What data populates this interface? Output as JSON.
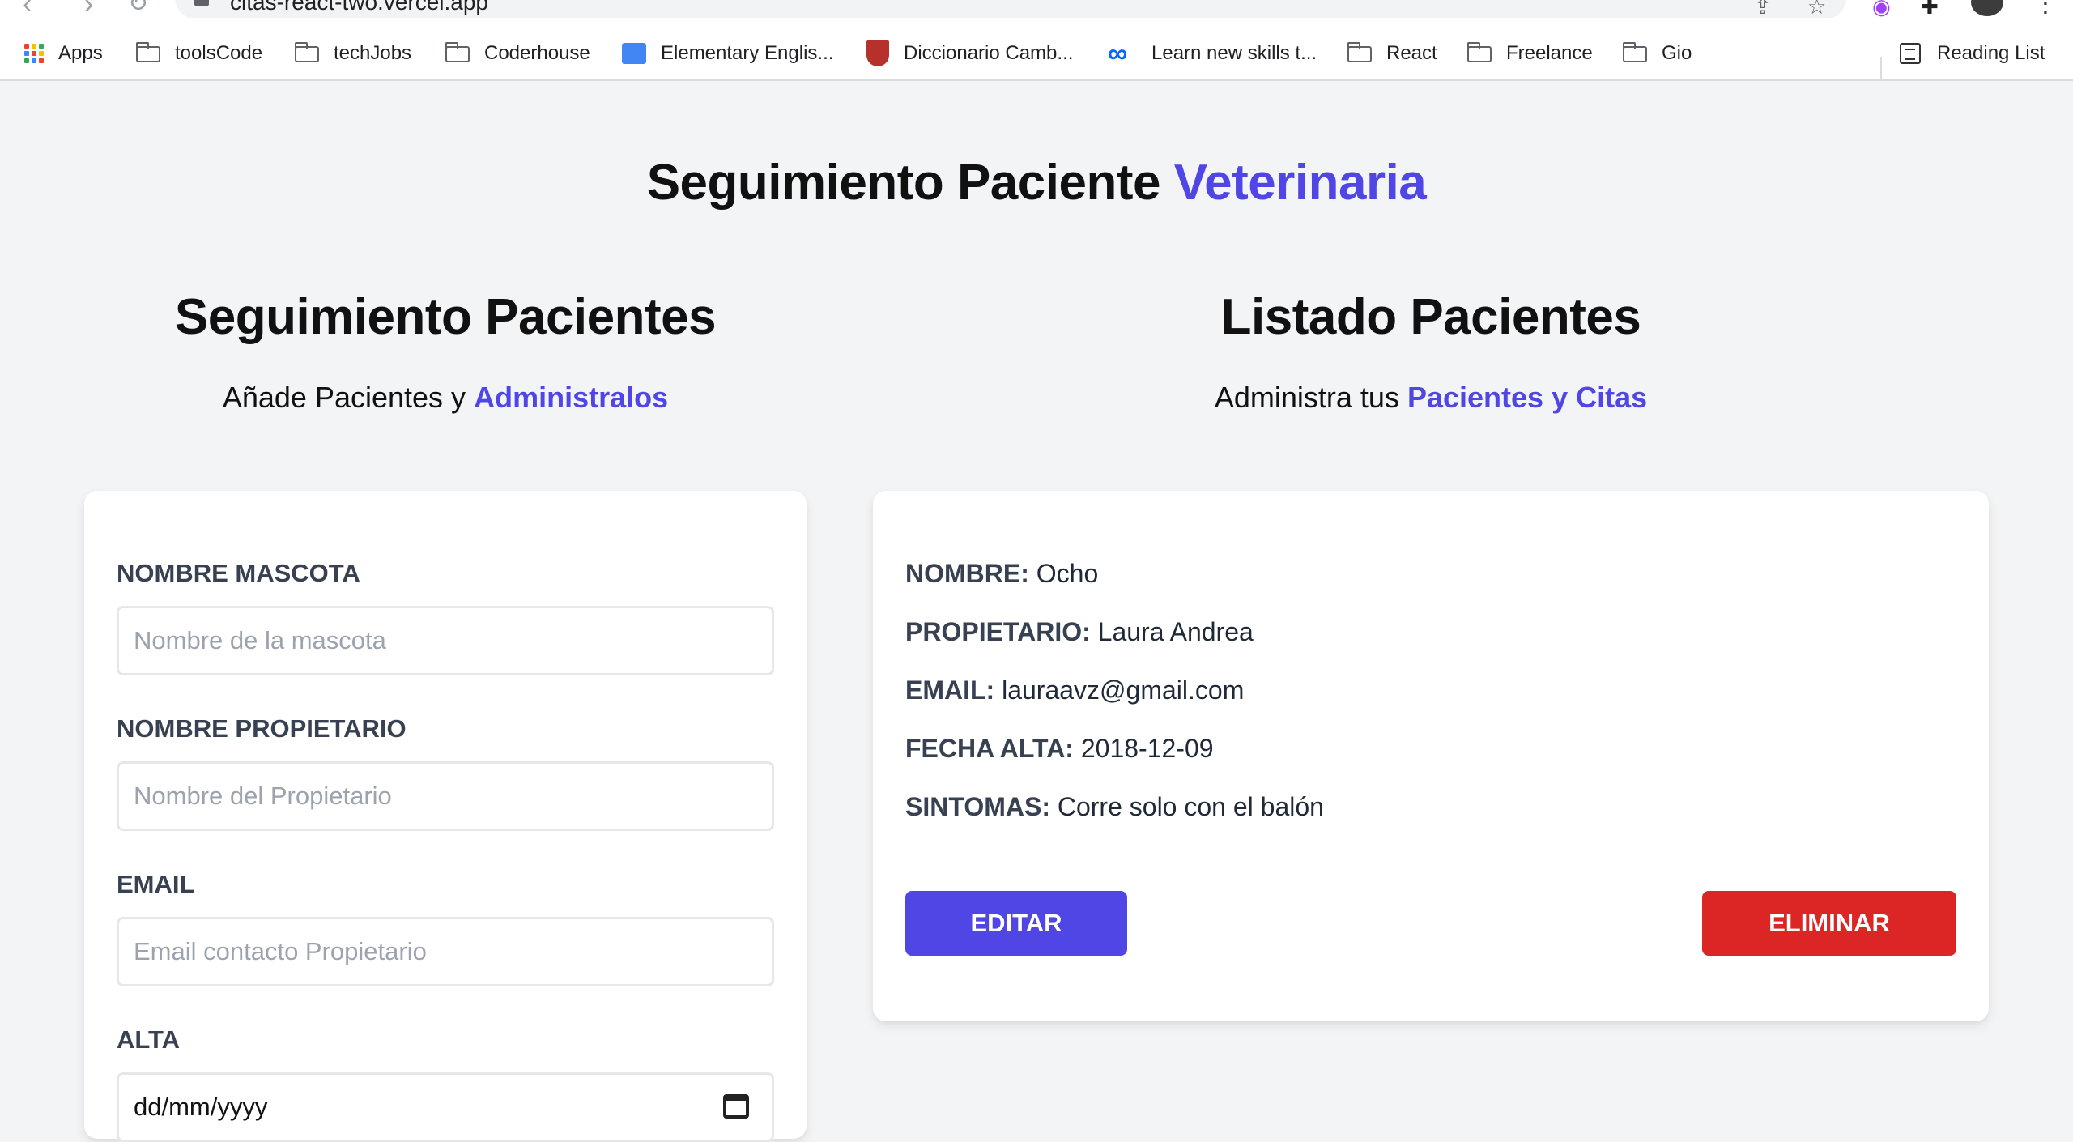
{
  "browser": {
    "url": "citas-react-two.vercel.app",
    "bookmarks": [
      {
        "label": "Apps",
        "icon": "apps-grid-icon"
      },
      {
        "label": "toolsCode",
        "icon": "folder-icon"
      },
      {
        "label": "techJobs",
        "icon": "folder-icon"
      },
      {
        "label": "Coderhouse",
        "icon": "folder-icon"
      },
      {
        "label": "Elementary Englis...",
        "icon": "contact-card-icon"
      },
      {
        "label": "Diccionario Camb...",
        "icon": "cambridge-shield-icon"
      },
      {
        "label": "Learn new skills t...",
        "icon": "meta-infinity-icon"
      },
      {
        "label": "React",
        "icon": "folder-icon"
      },
      {
        "label": "Freelance",
        "icon": "folder-icon"
      },
      {
        "label": "Gio",
        "icon": "folder-icon"
      }
    ],
    "reading_list": "Reading List"
  },
  "header": {
    "title_part1": "Seguimiento Paciente",
    "title_part2": "Veterinaria"
  },
  "form_section": {
    "title": "Seguimiento Pacientes",
    "subtitle_part1": "Añade Pacientes y",
    "subtitle_part2": "Administralos",
    "fields": [
      {
        "label": "NOMBRE MASCOTA",
        "placeholder": "Nombre de la mascota"
      },
      {
        "label": "NOMBRE PROPIETARIO",
        "placeholder": "Nombre del Propietario"
      },
      {
        "label": "EMAIL",
        "placeholder": "Email contacto Propietario"
      },
      {
        "label": "ALTA",
        "value": "dd/mm/yyyy"
      }
    ]
  },
  "list_section": {
    "title": "Listado Pacientes",
    "subtitle_part1": "Administra tus",
    "subtitle_part2": "Pacientes y Citas",
    "patient": {
      "nombre_label": "NOMBRE:",
      "nombre": "Ocho",
      "propietario_label": "PROPIETARIO:",
      "propietario": "Laura Andrea",
      "email_label": "EMAIL:",
      "email": "lauraavz@gmail.com",
      "fecha_label": "FECHA ALTA:",
      "fecha": "2018-12-09",
      "sintomas_label": "SINTOMAS:",
      "sintomas": "Corre solo con el balón"
    },
    "edit_button": "EDITAR",
    "delete_button": "ELIMINAR"
  },
  "colors": {
    "accent": "#4f46e5",
    "danger": "#dc2626",
    "background": "#f3f4f6"
  }
}
